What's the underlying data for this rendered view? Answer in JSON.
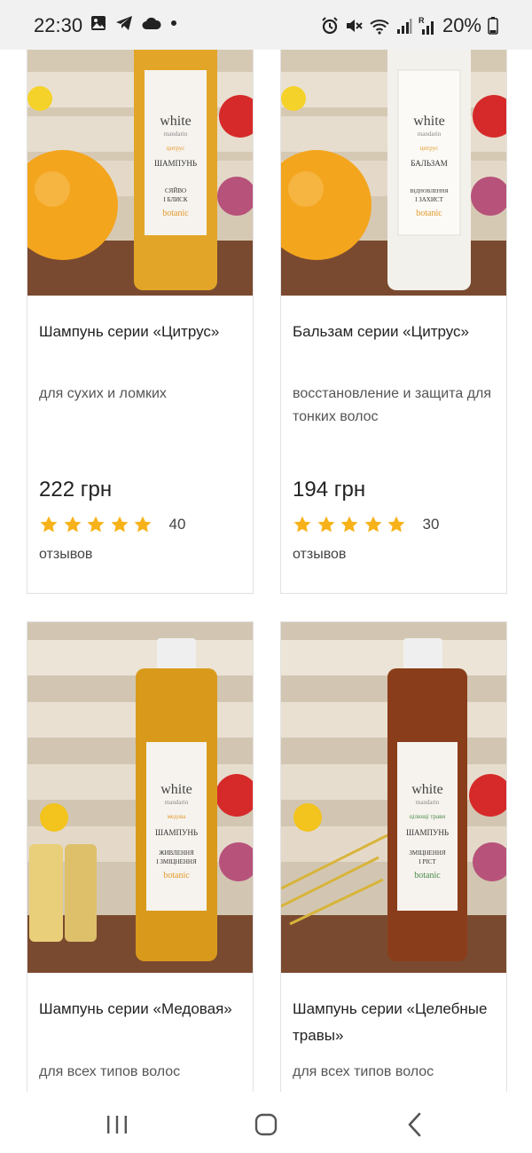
{
  "status_bar": {
    "time": "22:30",
    "battery": "20%",
    "left_icons": [
      "gallery-icon",
      "telegram-icon",
      "cloud-icon",
      "dot-icon"
    ],
    "right_icons": [
      "alarm-icon",
      "mute-icon",
      "wifi-icon",
      "signal-icon",
      "roaming-signal-icon",
      "battery-icon"
    ]
  },
  "products": [
    {
      "title": "Шампунь серии «Цитрус»",
      "subtitle": "для сухих и ломких",
      "price": "222 грн",
      "rating": 5,
      "review_count": "40",
      "reviews_word": "отзывов",
      "bottle_color": "#e3a528",
      "label": {
        "brand": "white",
        "sub": "mandarin",
        "series": "цитрус",
        "type": "ШАМПУНЬ",
        "line1": "СЯЙВО",
        "line2": "І БЛИСК",
        "botanic": "botanic"
      }
    },
    {
      "title": "Бальзам серии «Цитрус»",
      "subtitle": "восстановление и защита для тонких волос",
      "price": "194 грн",
      "rating": 5,
      "review_count": "30",
      "reviews_word": "отзывов",
      "bottle_color": "#f3f1ec",
      "label": {
        "brand": "white",
        "sub": "mandarin",
        "series": "цитрус",
        "type": "БАЛЬЗАМ",
        "line1": "ВІДНОВЛЕННЯ",
        "line2": "І ЗАХИСТ",
        "botanic": "botanic"
      }
    },
    {
      "title": "Шампунь серии «Медовая»",
      "subtitle": "для всех типов волос",
      "bottle_color": "#d99a1c",
      "label": {
        "brand": "white",
        "sub": "mandarin",
        "series": "медова",
        "type": "ШАМПУНЬ",
        "line1": "ЖИВЛЕННЯ",
        "line2": "І ЗМІЦНЕННЯ",
        "botanic": "botanic"
      }
    },
    {
      "title": "Шампунь серии «Целебные травы»",
      "subtitle": "для всех типов волос",
      "bottle_color": "#8a3d1a",
      "label": {
        "brand": "white",
        "sub": "mandarin",
        "series": "цілющі трави",
        "type": "ШАМПУНЬ",
        "line1": "ЗМІЦНЕННЯ",
        "line2": "І РІСТ",
        "botanic": "botanic"
      }
    }
  ],
  "nav_bar": {
    "buttons": [
      "recent-apps",
      "home",
      "back"
    ]
  },
  "colors": {
    "star": "#f7b21a",
    "card_border": "#e2e2e2",
    "status_bg": "#f1f1f1"
  }
}
